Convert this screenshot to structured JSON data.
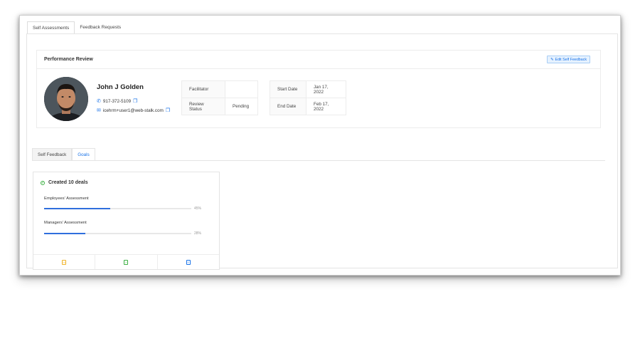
{
  "tabs": [
    {
      "label": "Self Assessments"
    },
    {
      "label": "Feedback Requests"
    }
  ],
  "review": {
    "title": "Performance Review",
    "edit_label": "Edit Self Feedback"
  },
  "user": {
    "name": "John J Golden",
    "phone": "917-372-5109",
    "email": "icehrm+user1@web-stalk.com"
  },
  "info_left": [
    {
      "label": "Facilitator",
      "value": ""
    },
    {
      "label": "Review Status",
      "value": "Pending"
    }
  ],
  "info_right": [
    {
      "label": "Start Date",
      "value": "Jan 17, 2022"
    },
    {
      "label": "End Date",
      "value": "Feb 17, 2022"
    }
  ],
  "sub_tabs": [
    {
      "label": "Self Feedback"
    },
    {
      "label": "Goals"
    }
  ],
  "goal": {
    "title": "Created 10 deals",
    "assessments": [
      {
        "label": "Employees' Assessment",
        "percent_text": "45%",
        "percent": 45
      },
      {
        "label": "Managers' Assessment",
        "percent_text": "28%",
        "percent": 28
      }
    ]
  },
  "colors": {
    "accent": "#2f6fdd",
    "success": "#3cb043",
    "warning": "#f0b429",
    "info": "#1a73e8"
  },
  "icons": {
    "phone": "phone-icon",
    "email": "mail-icon",
    "copy": "copy-icon",
    "edit": "edit-icon",
    "goal_status": "check-circle-icon",
    "footer": [
      "calendar-icon",
      "checklist-icon",
      "document-icon"
    ]
  }
}
